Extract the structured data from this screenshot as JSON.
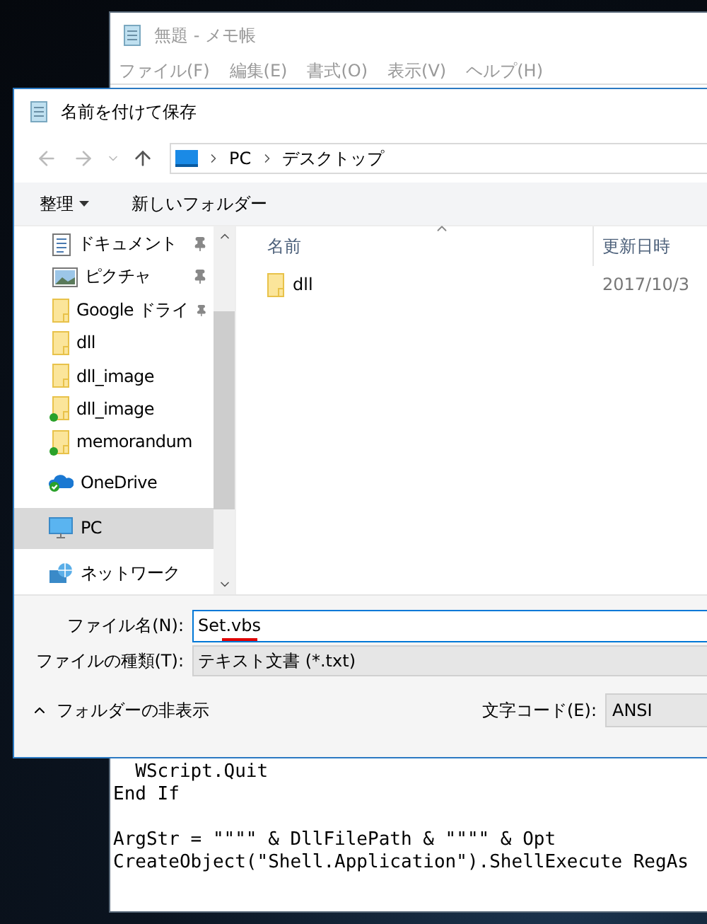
{
  "notepad": {
    "title": "無題 - メモ帳",
    "menu": [
      "ファイル(F)",
      "編集(E)",
      "書式(O)",
      "表示(V)",
      "ヘルプ(H)"
    ],
    "paragraphs": [
      [
        "  WScript.Quit",
        "End If"
      ],
      [
        "ArgStr = \"\"\"\" & DllFilePath & \"\"\"\" & Opt",
        "CreateObject(\"Shell.Application\").ShellExecute RegAs"
      ]
    ]
  },
  "dialog": {
    "title": "名前を付けて保存",
    "address": [
      "PC",
      "デスクトップ"
    ],
    "toolbar": [
      {
        "label": "整理",
        "dropdown": true
      },
      {
        "label": "新しいフォルダー",
        "dropdown": false
      }
    ],
    "nav_items": [
      {
        "label": "ドキュメント",
        "kind": "documents",
        "pinned": true,
        "synced": false,
        "selected": false
      },
      {
        "label": "ピクチャ",
        "kind": "pictures",
        "pinned": true,
        "synced": false,
        "selected": false
      },
      {
        "label": "Google ドライ",
        "kind": "folder",
        "pinned": true,
        "synced": false,
        "selected": false
      },
      {
        "label": "dll",
        "kind": "folder",
        "pinned": false,
        "synced": false,
        "selected": false
      },
      {
        "label": "dll_image",
        "kind": "folder",
        "pinned": false,
        "synced": false,
        "selected": false
      },
      {
        "label": "dll_image",
        "kind": "folder",
        "pinned": false,
        "synced": true,
        "selected": false
      },
      {
        "label": "memorandum",
        "kind": "folder",
        "pinned": false,
        "synced": true,
        "selected": false
      },
      {
        "label": "OneDrive",
        "kind": "onedrive",
        "pinned": false,
        "synced": false,
        "selected": false
      },
      {
        "label": "PC",
        "kind": "pc",
        "pinned": false,
        "synced": false,
        "selected": true
      },
      {
        "label": "ネットワーク",
        "kind": "network",
        "pinned": false,
        "synced": false,
        "selected": false
      }
    ],
    "columns": [
      "名前",
      "更新日時"
    ],
    "files": [
      {
        "name": "dll",
        "modified": "2017/10/3"
      }
    ],
    "file_name": {
      "label": "ファイル名(N):",
      "value": "Set.vbs"
    },
    "file_type": {
      "label": "ファイルの種類(T):",
      "value": "テキスト文書 (*.txt)"
    },
    "hide_folders": "フォルダーの非表示",
    "encoding": {
      "label": "文字コード(E):",
      "value": "ANSI"
    }
  }
}
